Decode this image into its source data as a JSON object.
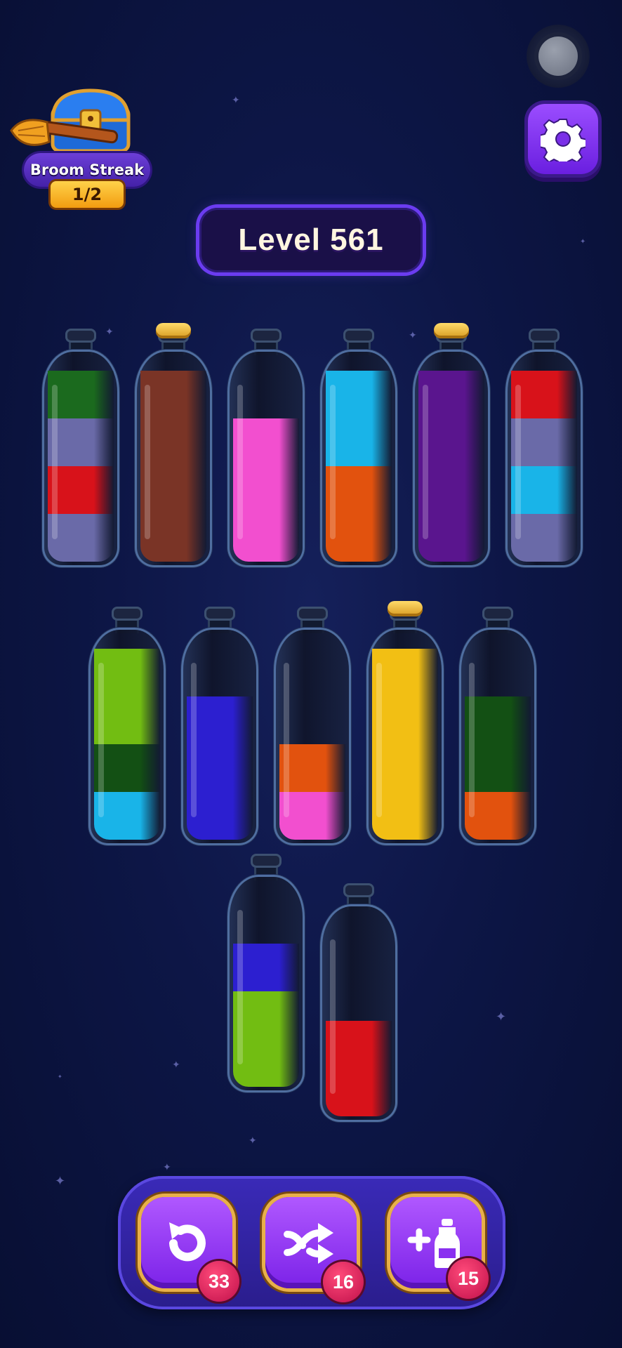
{
  "level": {
    "label": "Level 561"
  },
  "broom_streak": {
    "label": "Broom Streak",
    "progress": "1/2"
  },
  "powerups": [
    {
      "name": "undo",
      "icon": "undo-icon",
      "count": "33"
    },
    {
      "name": "shuffle",
      "icon": "shuffle-icon",
      "count": "16"
    },
    {
      "name": "add-bottle",
      "icon": "add-bottle-icon",
      "count": "15"
    }
  ],
  "colors": {
    "dark_green": "#1b6a1e",
    "lavender": "#6a6aa8",
    "red": "#d8121a",
    "brown": "#7a3426",
    "pink": "#f24fcf",
    "cyan": "#19b4e8",
    "orange": "#e2520e",
    "purple": "#5a158e",
    "lime": "#72bd12",
    "blue": "#2c1fd0",
    "yellow": "#f2bf14",
    "forest": "#135014"
  },
  "bottles": [
    {
      "id": 1,
      "corked": false,
      "layers_bottom_to_top": [
        "lavender",
        "red",
        "lavender",
        "dark_green"
      ]
    },
    {
      "id": 2,
      "corked": true,
      "layers_bottom_to_top": [
        "brown",
        "brown",
        "brown",
        "brown"
      ]
    },
    {
      "id": 3,
      "corked": false,
      "layers_bottom_to_top": [
        "pink",
        "pink",
        "pink"
      ]
    },
    {
      "id": 4,
      "corked": false,
      "layers_bottom_to_top": [
        "orange",
        "orange",
        "cyan",
        "cyan"
      ]
    },
    {
      "id": 5,
      "corked": true,
      "layers_bottom_to_top": [
        "purple",
        "purple",
        "purple",
        "purple"
      ]
    },
    {
      "id": 6,
      "corked": false,
      "layers_bottom_to_top": [
        "lavender",
        "cyan",
        "lavender",
        "red"
      ]
    },
    {
      "id": 7,
      "corked": false,
      "layers_bottom_to_top": [
        "cyan",
        "forest",
        "lime",
        "lime"
      ]
    },
    {
      "id": 8,
      "corked": false,
      "layers_bottom_to_top": [
        "blue",
        "blue",
        "blue"
      ]
    },
    {
      "id": 9,
      "corked": false,
      "layers_bottom_to_top": [
        "pink",
        "orange"
      ]
    },
    {
      "id": 10,
      "corked": true,
      "layers_bottom_to_top": [
        "yellow",
        "yellow",
        "yellow",
        "yellow"
      ]
    },
    {
      "id": 11,
      "corked": false,
      "layers_bottom_to_top": [
        "orange",
        "forest",
        "forest"
      ]
    },
    {
      "id": 12,
      "corked": false,
      "layers_bottom_to_top": [
        "lime",
        "lime",
        "blue"
      ]
    },
    {
      "id": 13,
      "corked": false,
      "layers_bottom_to_top": [
        "red",
        "red"
      ]
    }
  ]
}
